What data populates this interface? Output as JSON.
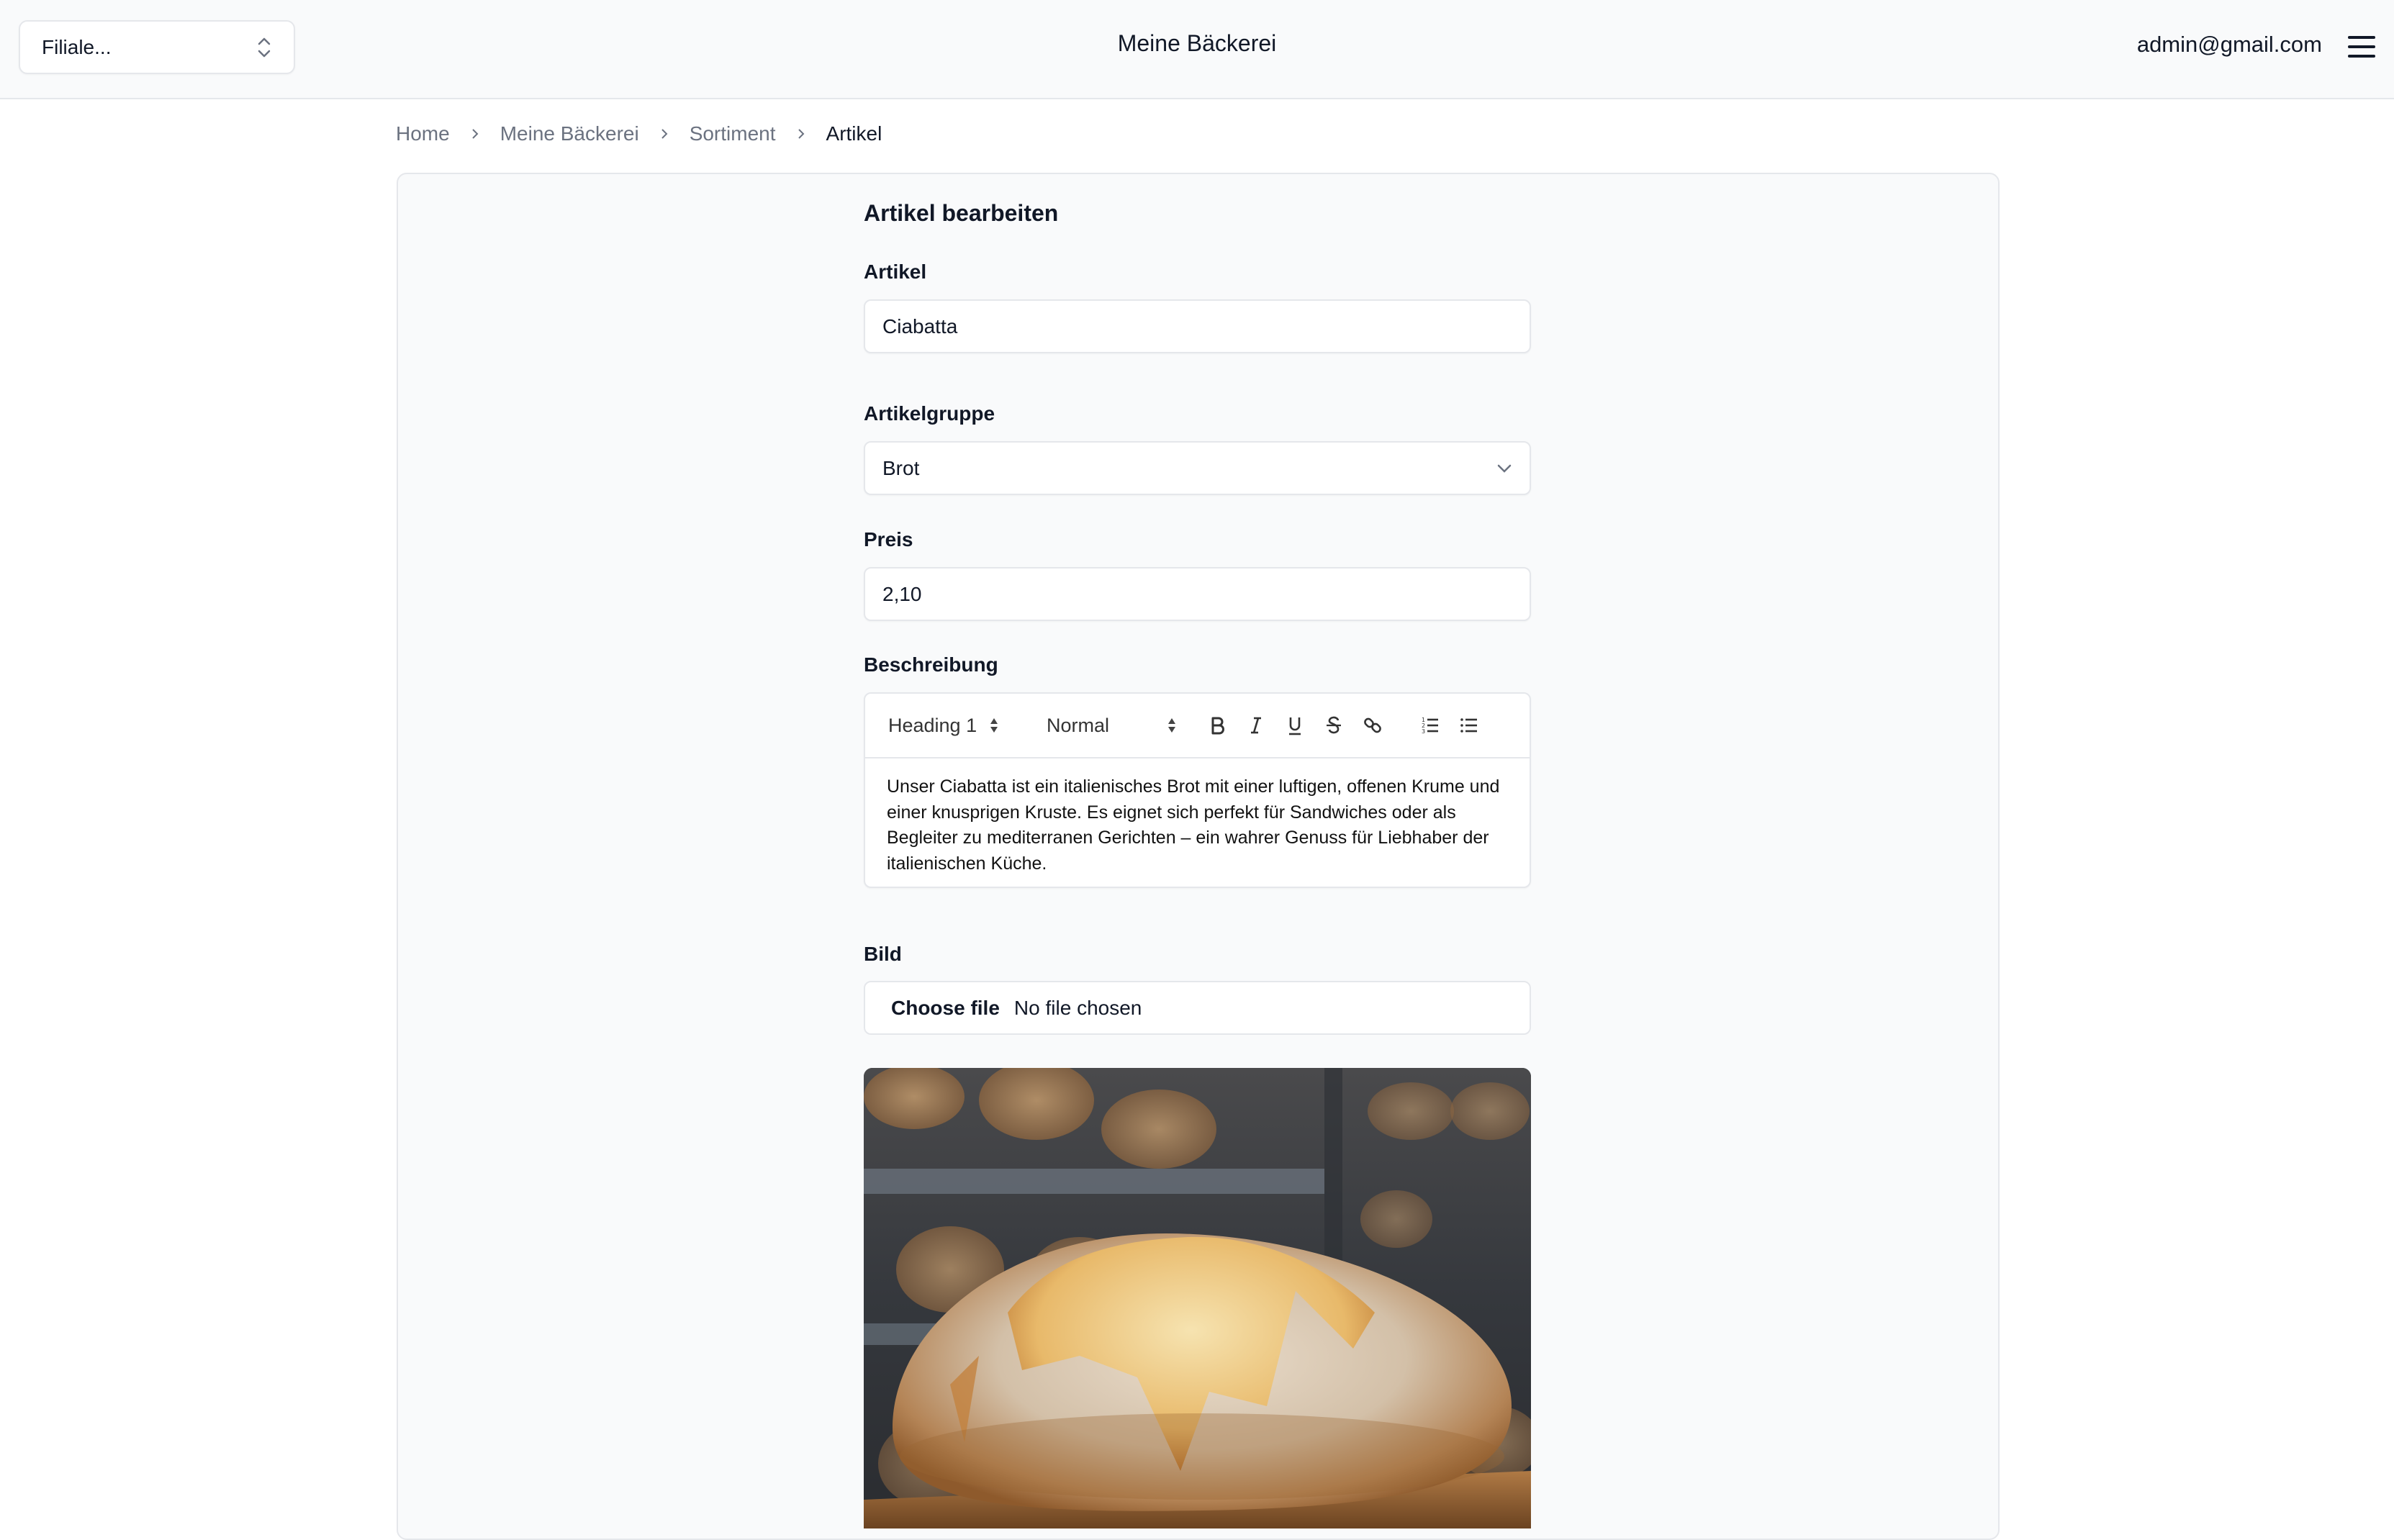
{
  "header": {
    "branch_select": {
      "placeholder": "Filiale...",
      "icon": "chevron-up-down-icon"
    },
    "app_title": "Meine Bäckerei",
    "user_email": "admin@gmail.com",
    "menu_icon": "hamburger-menu-icon"
  },
  "breadcrumb": [
    {
      "label": "Home"
    },
    {
      "label": "Meine Bäckerei"
    },
    {
      "label": "Sortiment"
    },
    {
      "label": "Artikel",
      "current": true
    }
  ],
  "form": {
    "title": "Artikel bearbeiten",
    "fields": {
      "artikel": {
        "label": "Artikel",
        "value": "Ciabatta"
      },
      "artikelgruppe": {
        "label": "Artikelgruppe",
        "value": "Brot"
      },
      "preis": {
        "label": "Preis",
        "value": "2,10"
      },
      "beschreibung": {
        "label": "Beschreibung",
        "toolbar": {
          "heading_select": "Heading 1",
          "size_select": "Normal",
          "buttons": [
            "bold",
            "italic",
            "underline",
            "strikethrough",
            "link",
            "ordered-list",
            "bullet-list"
          ]
        },
        "content": "Unser Ciabatta ist ein italienisches Brot mit einer luftigen, offenen Krume und einer knusprigen Kruste. Es eignet sich perfekt für Sandwiches oder als Begleiter zu mediterranen Gerichten – ein wahrer Genuss für Liebhaber der italienischen Küche."
      },
      "bild": {
        "label": "Bild",
        "button_label": "Choose file",
        "status": "No file chosen",
        "preview_alt": "Ciabatta loaf on wooden board in bakery"
      }
    }
  }
}
